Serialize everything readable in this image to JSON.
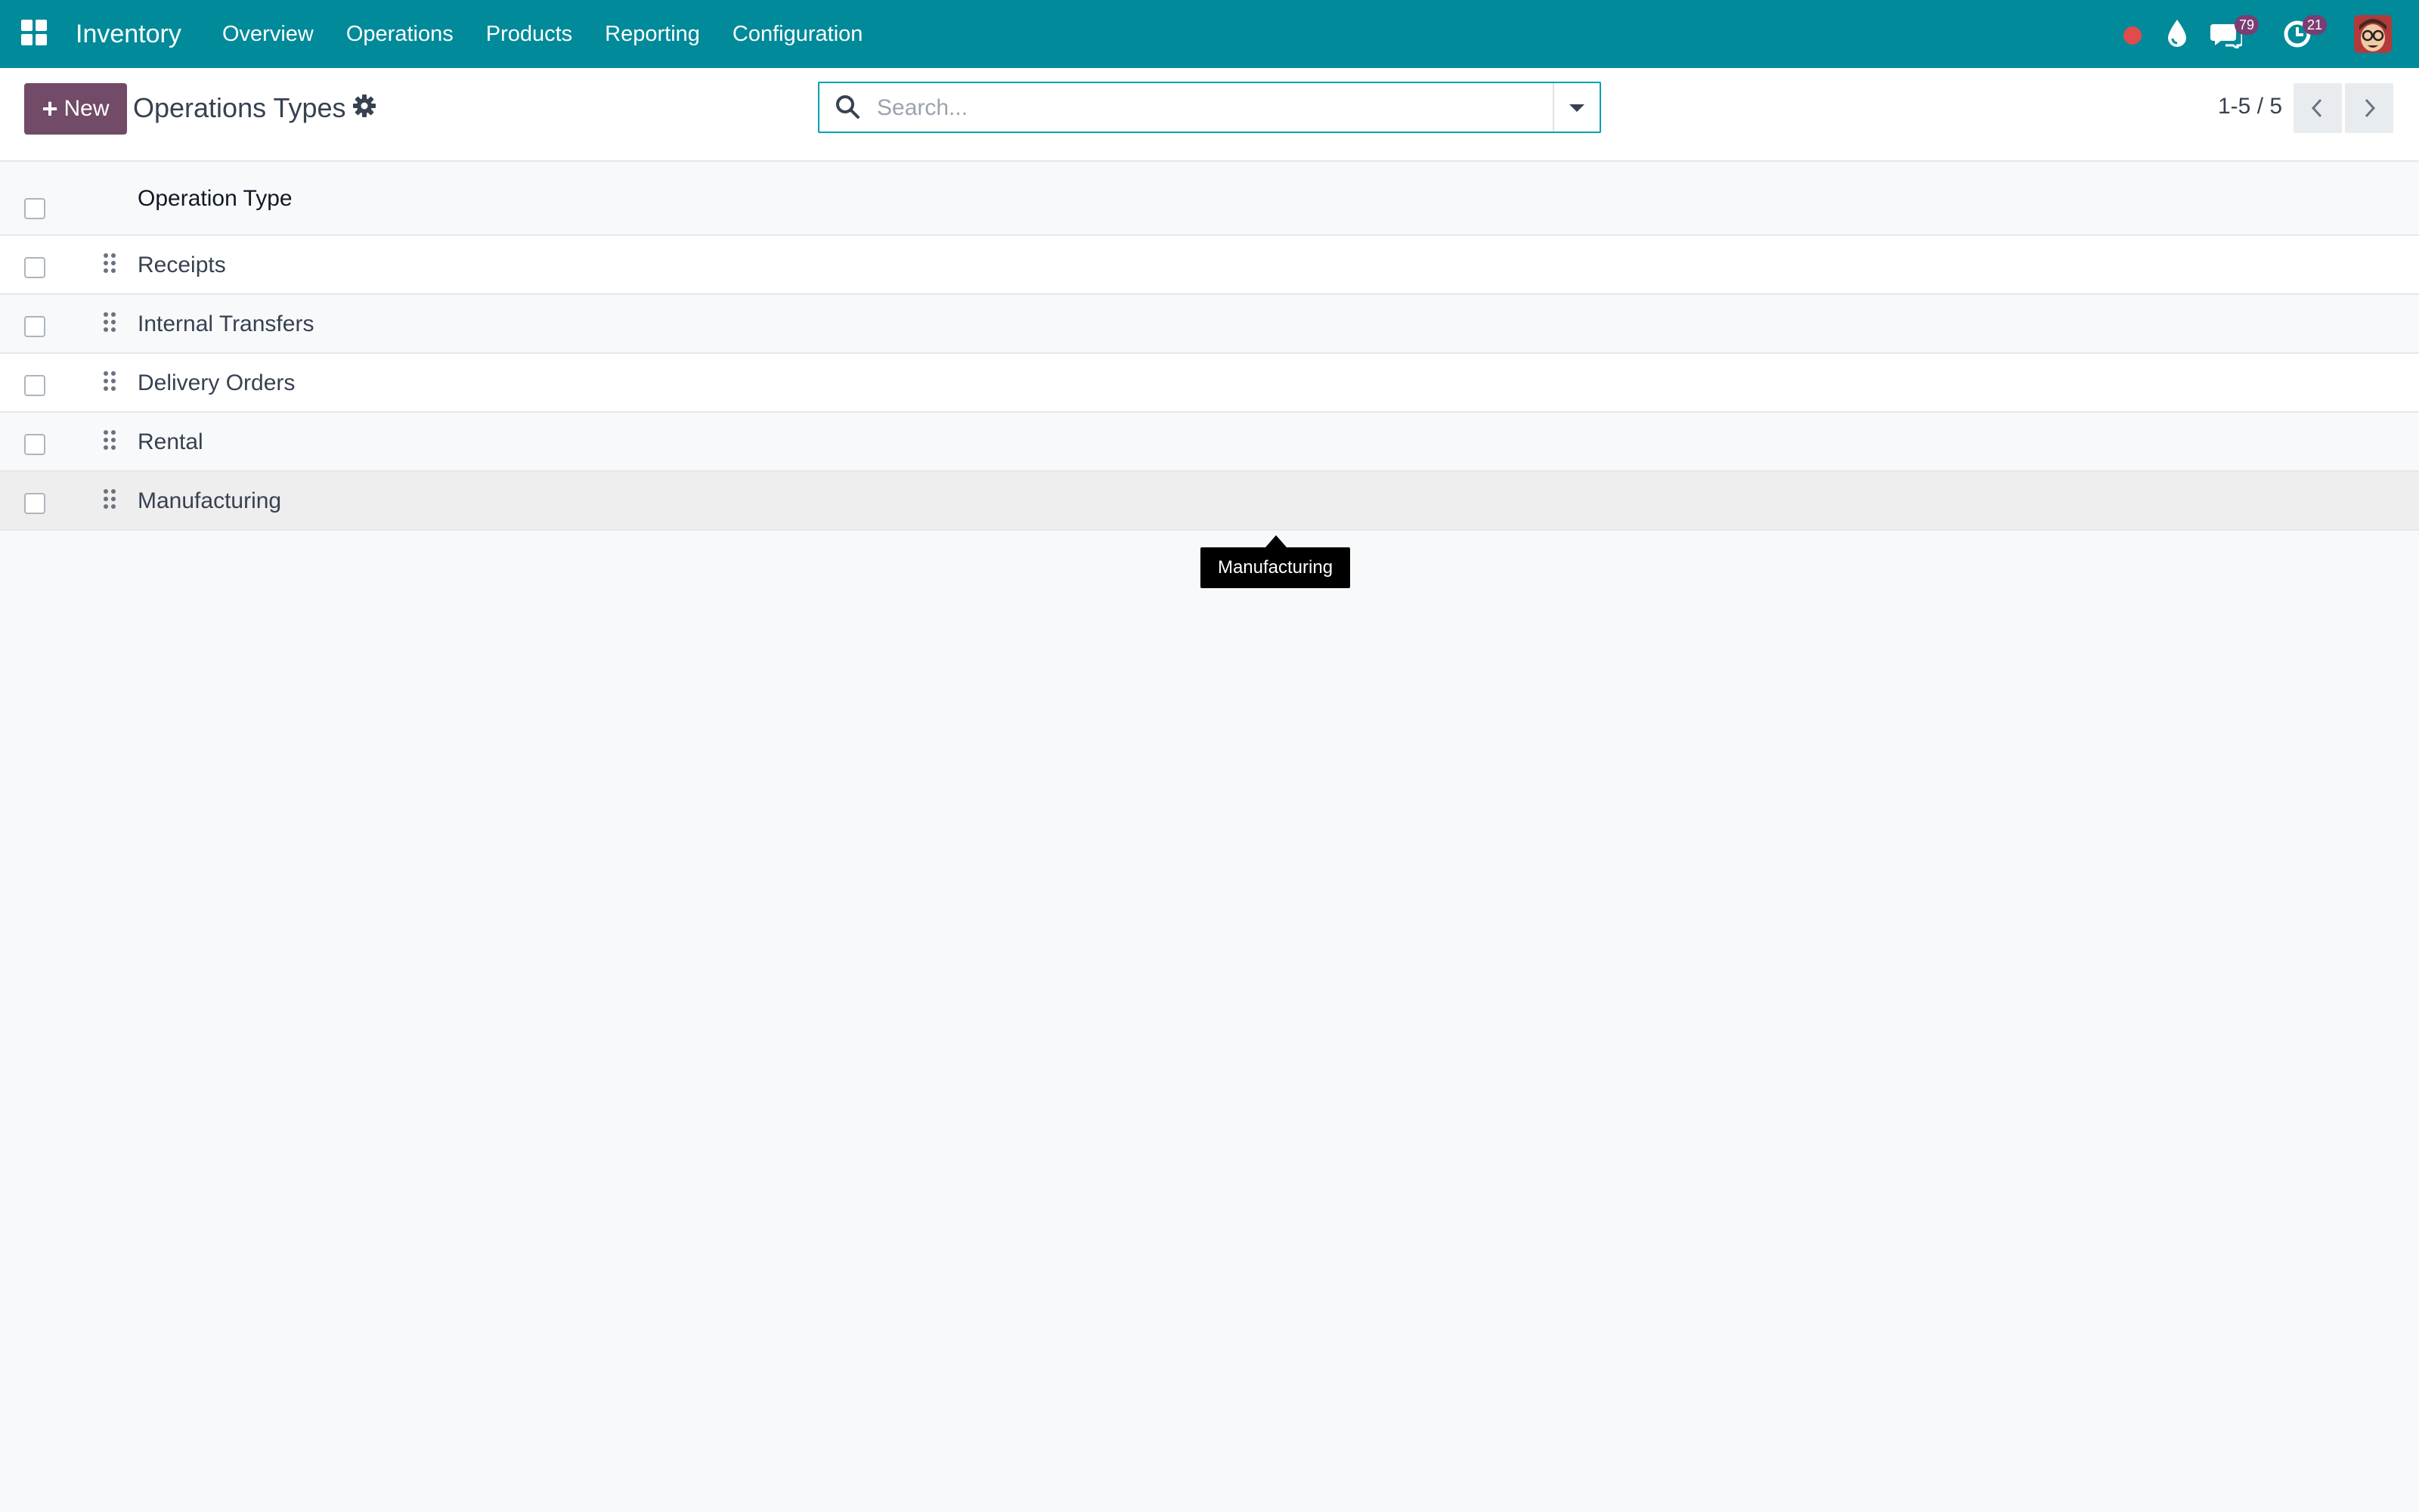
{
  "navbar": {
    "app_name": "Inventory",
    "menu": [
      "Overview",
      "Operations",
      "Products",
      "Reporting",
      "Configuration"
    ],
    "messages_count": "79",
    "activities_count": "21",
    "colors": {
      "bar": "#018a9a",
      "badge": "#7b3d73",
      "recording_dot": "#e04b4b"
    }
  },
  "control_panel": {
    "new_label": "New",
    "title": "Operations Types",
    "search_placeholder": "Search...",
    "pager_value": "1-5 / 5"
  },
  "list": {
    "column_header": "Operation Type",
    "rows": [
      "Receipts",
      "Internal Transfers",
      "Delivery Orders",
      "Rental",
      "Manufacturing"
    ]
  },
  "tooltip": {
    "text": "Manufacturing"
  }
}
